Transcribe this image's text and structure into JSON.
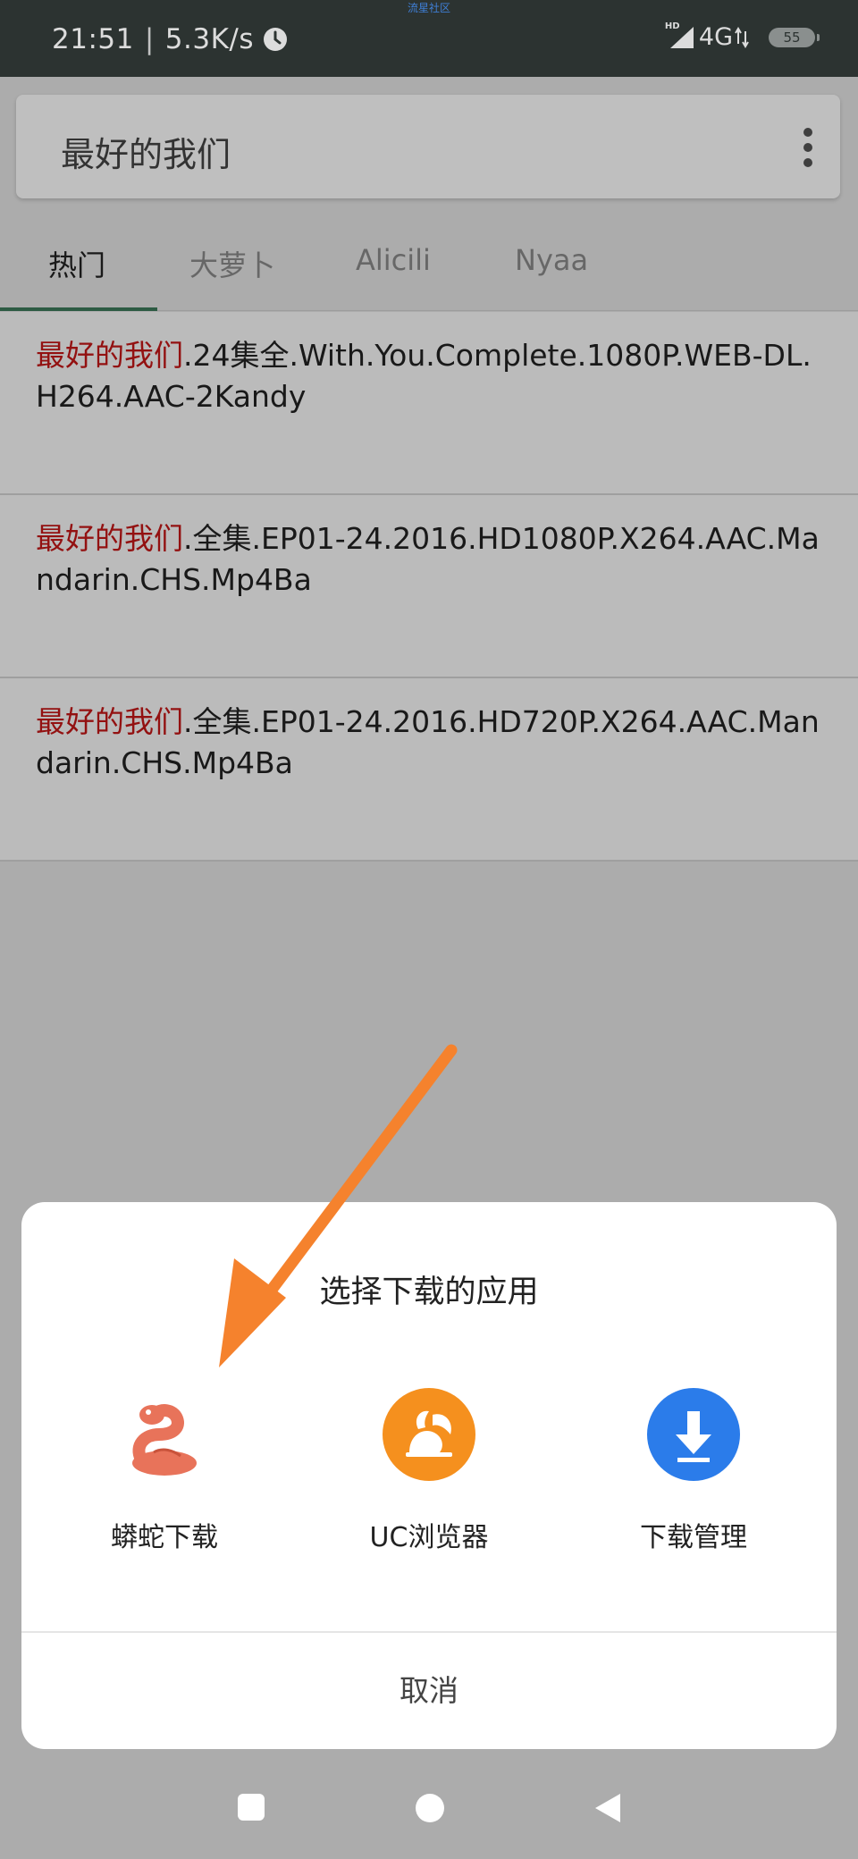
{
  "status_bar": {
    "watermark": "流星社区",
    "time": "21:51",
    "separator": "|",
    "speed": "5.3K/s",
    "signal_badge": "HD",
    "network": "4G",
    "battery": "55"
  },
  "search": {
    "query": "最好的我们"
  },
  "tabs": [
    {
      "label": "热门",
      "active": true
    },
    {
      "label": "大萝卜",
      "active": false
    },
    {
      "label": "Alicili",
      "active": false
    },
    {
      "label": "Nyaa",
      "active": false
    }
  ],
  "results": [
    {
      "highlight": "最好的我们",
      "rest": ".24集全.With.You.Complete.1080P.WEB-DL.H264.AAC-2Kandy"
    },
    {
      "highlight": "最好的我们",
      "rest": ".全集.EP01-24.2016.HD1080P.X264.AAC.Mandarin.CHS.Mp4Ba"
    },
    {
      "highlight": "最好的我们",
      "rest": ".全集.EP01-24.2016.HD720P.X264.AAC.Mandarin.CHS.Mp4Ba"
    }
  ],
  "dialog": {
    "title": "选择下载的应用",
    "apps": [
      {
        "label": "蟒蛇下载",
        "icon": "python-snake-icon"
      },
      {
        "label": "UC浏览器",
        "icon": "uc-squirrel-icon"
      },
      {
        "label": "下载管理",
        "icon": "download-arrow-icon"
      }
    ],
    "cancel": "取消"
  },
  "colors": {
    "status_bar": "#2c3331",
    "highlight": "#c41717",
    "tab_indicator": "#3c7a5a",
    "snake": "#e8735a",
    "uc_orange": "#f5901e",
    "download_blue": "#2b7cea",
    "arrow": "#f5822d"
  }
}
